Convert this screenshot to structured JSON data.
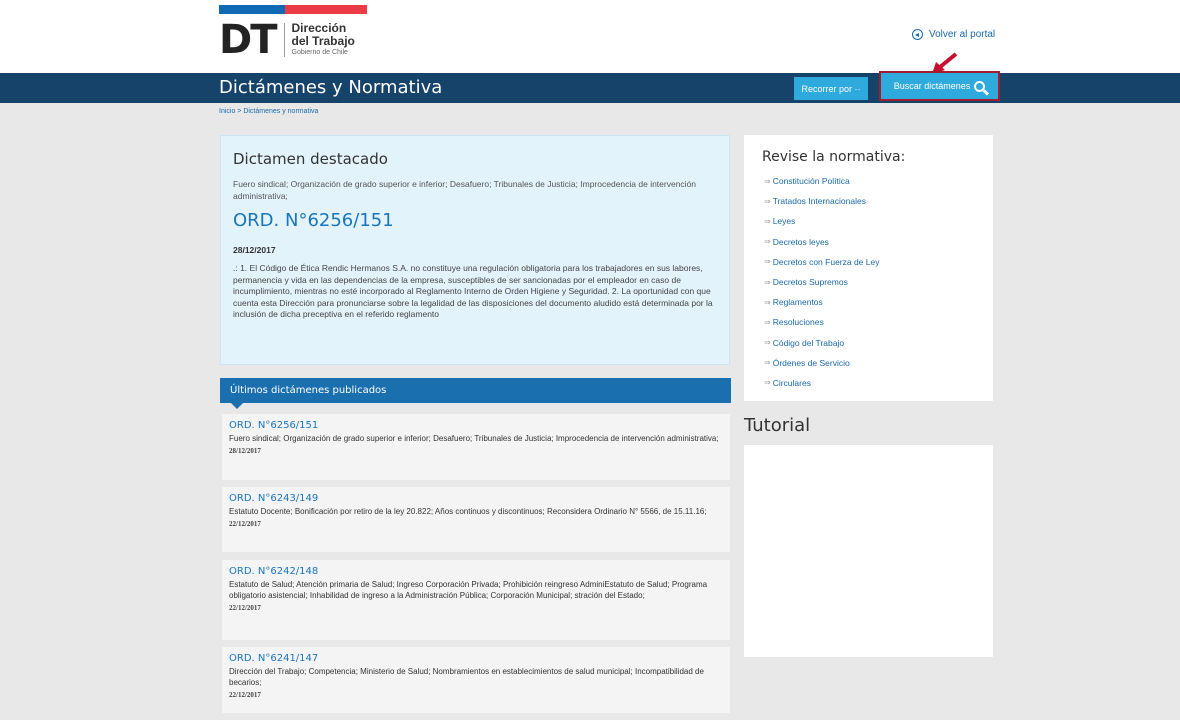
{
  "header": {
    "logo_mark": "DT",
    "logo_line1": "Dirección",
    "logo_line2": "del Trabajo",
    "logo_line3": "Gobierno de Chile",
    "back_link": "Volver al portal"
  },
  "navbar": {
    "title": "Dictámenes y Normativa",
    "browse_button": "Recorrer por ··",
    "search_button": "Buscar dictámenes"
  },
  "breadcrumb": "Inicio > Dictámenes y normativa",
  "featured": {
    "heading": "Dictamen destacado",
    "tags": "Fuero sindical; Organización de grado superior e inferior; Desafuero; Tribunales de Justicia; Improcedencia de intervención administrativa;",
    "ord": "ORD. N°6256/151",
    "date": "28/12/2017",
    "description": ".: 1. El Código de Ética Rendic Hermanos S.A. no constituye una regulación obligatoria para los trabajadores en sus labores, permanencia y vida en las dependencias de la empresa, susceptibles de ser sancionadas por el empleador en caso de incumplimiento, mientras no esté incorporado al Reglamento Interno de Orden Higiene y Seguridad. 2. La oportunidad con que cuenta esta Dirección para pronunciarse sobre la legalidad de las disposiciones del documento aludido está determinada por la inclusión de dicha preceptiva en el referido reglamento"
  },
  "latest": {
    "heading": "Últimos dictámenes publicados",
    "items": [
      {
        "title": "ORD. N°6256/151",
        "desc": "Fuero sindical; Organización de grado superior e inferior; Desafuero; Tribunales de Justicia; Improcedencia de intervención administrativa;",
        "date": "28/12/2017"
      },
      {
        "title": "ORD. N°6243/149",
        "desc": "Estatuto Docente; Bonificación por retiro de la ley 20.822; Años continuos y discontinuos; Reconsidera Ordinario N° 5566, de 15.11.16;",
        "date": "22/12/2017"
      },
      {
        "title": "ORD. N°6242/148",
        "desc": "Estatuto de Salud; Atención primaria de Salud; Ingreso Corporación Privada; Prohibición reingreso AdminiEstatuto de Salud; Programa obligatorio asistencial; Inhabilidad de ingreso a la Administración Pública; Corporación Municipal; stración del Estado;",
        "date": "22/12/2017"
      },
      {
        "title": "ORD. N°6241/147",
        "desc": "Dirección del Trabajo; Competencia; Ministerio de Salud; Nombramientos en establecimientos de salud municipal; Incompatibilidad de becarios;",
        "date": "22/12/2017"
      }
    ]
  },
  "sidebar": {
    "heading": "Revise la normativa:",
    "links": [
      "Constitución Política",
      "Tratados Internacionales",
      "Leyes",
      "Decretos leyes",
      "Decretos con Fuerza de Ley",
      "Decretos Supremos",
      "Reglamentos",
      "Resoluciones",
      "Código del Trabajo",
      "Órdenes de Servicio",
      "Circulares"
    ]
  },
  "tutorial": {
    "heading": "Tutorial"
  },
  "colors": {
    "navbar": "#16436a",
    "accent_button": "#2eaadc",
    "highlight_border": "#a21d2e",
    "link": "#1a75bb"
  }
}
